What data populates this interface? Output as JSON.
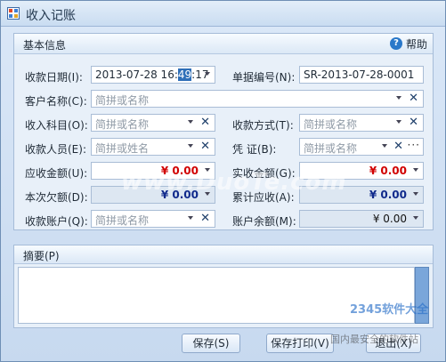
{
  "window": {
    "title": "收入记账"
  },
  "section": {
    "title": "基本信息",
    "help_label": "帮助"
  },
  "fields": {
    "date": {
      "label": "收款日期(I):",
      "before": "2013-07-28 16:",
      "highlight": "49",
      "after": ":17"
    },
    "doc_no": {
      "label": "单据编号(N):",
      "value": "SR-2013-07-28-0001"
    },
    "customer": {
      "label": "客户名称(C):",
      "placeholder": "简拼或名称"
    },
    "subject": {
      "label": "收入科目(O):",
      "placeholder": "简拼或名称"
    },
    "method": {
      "label": "收款方式(T):",
      "placeholder": "简拼或名称"
    },
    "person": {
      "label": "收款人员(E):",
      "placeholder": "简拼或姓名"
    },
    "voucher": {
      "label": "凭  证(B):",
      "placeholder": "简拼或名称"
    },
    "receivable": {
      "label": "应收金额(U):",
      "value": "¥ 0.00"
    },
    "received": {
      "label": "实收金额(G):",
      "value": "¥ 0.00"
    },
    "owed": {
      "label": "本次欠额(D):",
      "value": "¥ 0.00"
    },
    "cumulative": {
      "label": "累计应收(A):",
      "value": "¥ 0.00"
    },
    "account": {
      "label": "收款账户(Q):",
      "placeholder": "简拼或名称"
    },
    "balance": {
      "label": "账户余额(M):",
      "value": "¥ 0.00"
    }
  },
  "memo": {
    "label": "摘要(P)"
  },
  "buttons": {
    "save": "保存(S)",
    "save_print": "保存打印(V)",
    "exit": "退出(X)"
  },
  "watermarks": {
    "site": "www.DuoTe.com",
    "brand": "2345软件大全",
    "brand_sub": "国内最安全的软件站"
  }
}
